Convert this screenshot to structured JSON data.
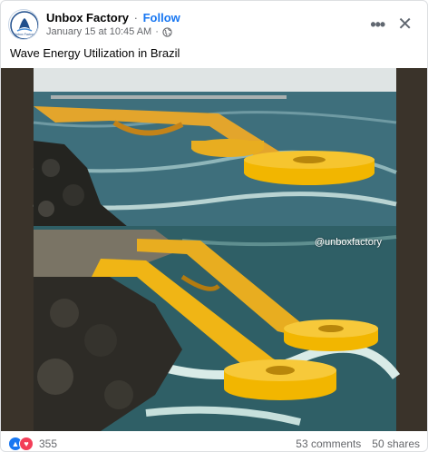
{
  "post": {
    "page_name": "Unbox Factory",
    "separator": "·",
    "follow_label": "Follow",
    "timestamp": "January 15 at 10:45 AM",
    "timestamp_sep": "·",
    "caption": "Wave Energy Utilization in Brazil",
    "watermark": "@unboxfactory"
  },
  "avatar": {
    "text": "Unbox Factory"
  },
  "icons": {
    "avatar": "unbox-factory-logo",
    "privacy": "globe-icon",
    "more": "more-horizontal-icon",
    "close": "close-icon",
    "like": "like-icon",
    "love": "love-icon"
  },
  "engagement": {
    "reactions_count": "355",
    "comments": "53 comments",
    "shares": "50 shares"
  },
  "colors": {
    "accent": "#1877f2",
    "secondary_text": "#65676b",
    "love": "#f33e58",
    "structure_yellow": "#f2b600"
  }
}
